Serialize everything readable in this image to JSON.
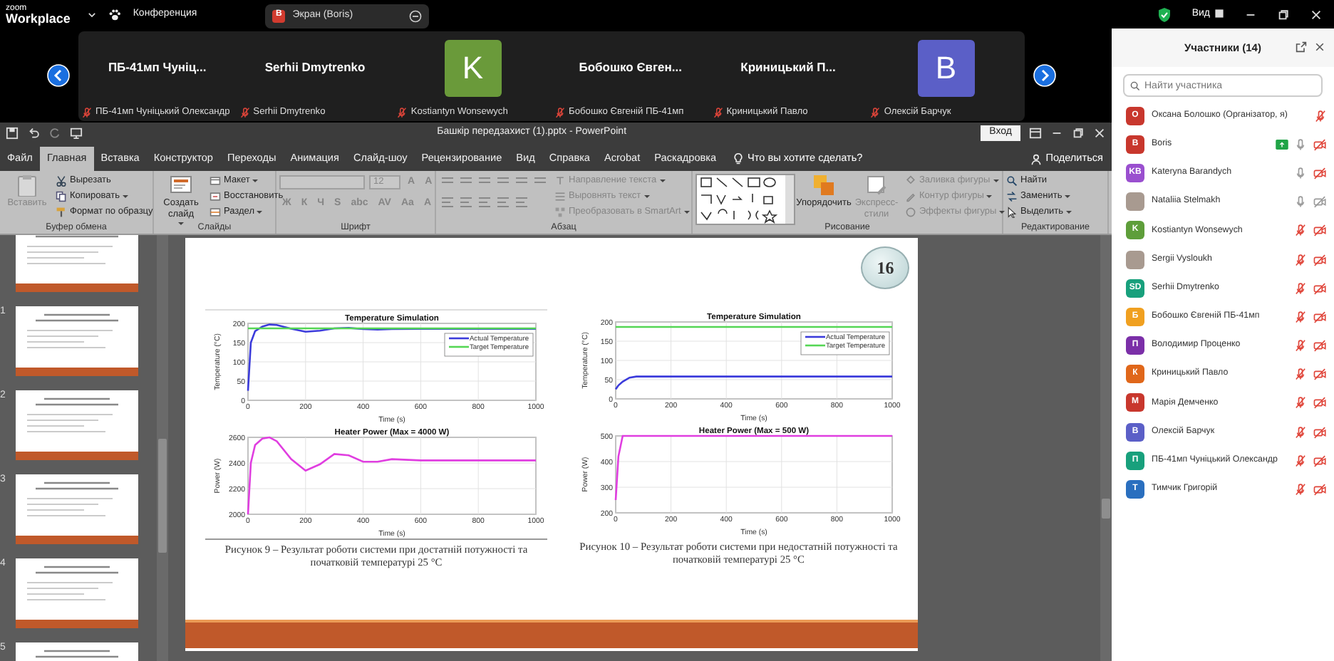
{
  "zoom": {
    "logo_small": "zoom",
    "logo": "Workplace",
    "meeting_menu": "Конференция",
    "share_pill": {
      "initial": "B",
      "label": "Экран (Boris)"
    },
    "view_label": "Вид"
  },
  "gallery": {
    "tiles": [
      {
        "kind": "name",
        "display": "ПБ-41мп Чуніц...",
        "tag": "ПБ-41мп Чуніцький Олександр",
        "muted": true
      },
      {
        "kind": "name",
        "display": "Serhii Dmytrenko",
        "tag": "Serhii Dmytrenko",
        "muted": true
      },
      {
        "kind": "avatar",
        "display": "K",
        "color": "#6a9a3a",
        "tag": "Kostiantyn Wonsewych",
        "muted": true
      },
      {
        "kind": "name",
        "display": "Бобошко Євген...",
        "tag": "Бобошко Євгеній ПБ-41мп",
        "muted": true
      },
      {
        "kind": "name",
        "display": "Криницький П...",
        "tag": "Криницький Павло",
        "muted": true
      },
      {
        "kind": "avatar",
        "display": "B",
        "color": "#5b5fc7",
        "tag": "Олексій Барчук",
        "muted": true
      }
    ]
  },
  "powerpoint": {
    "title": "Башкір передзахист (1).pptx - PowerPoint",
    "signin": "Вход",
    "tabs": [
      {
        "label": "Файл",
        "selected": false
      },
      {
        "label": "Главная",
        "selected": true
      },
      {
        "label": "Вставка",
        "selected": false
      },
      {
        "label": "Конструктор",
        "selected": false
      },
      {
        "label": "Переходы",
        "selected": false
      },
      {
        "label": "Анимация",
        "selected": false
      },
      {
        "label": "Слайд-шоу",
        "selected": false
      },
      {
        "label": "Рецензирование",
        "selected": false
      },
      {
        "label": "Вид",
        "selected": false
      },
      {
        "label": "Справка",
        "selected": false
      },
      {
        "label": "Acrobat",
        "selected": false
      },
      {
        "label": "Раскадровка",
        "selected": false
      }
    ],
    "search_hint": "Что вы хотите сделать?",
    "share": "Поделиться",
    "ribbon": {
      "groups": [
        {
          "label": "Буфер обмена",
          "items": [
            {
              "kind": "large",
              "label": "Вставить",
              "disabled": true,
              "dropdown": false
            },
            {
              "kind": "small",
              "label": "Вырезать",
              "disabled": false,
              "dropdown": false
            },
            {
              "kind": "small",
              "label": "Копировать",
              "disabled": false,
              "dropdown": true
            },
            {
              "kind": "small",
              "label": "Формат по образцу",
              "disabled": false,
              "dropdown": false
            }
          ]
        },
        {
          "label": "Слайды",
          "items": [
            {
              "kind": "large",
              "label": "Создать слайд",
              "disabled": false,
              "dropdown": true
            },
            {
              "kind": "small",
              "label": "Макет",
              "disabled": false,
              "dropdown": true
            },
            {
              "kind": "small",
              "label": "Восстановить",
              "disabled": false,
              "dropdown": false
            },
            {
              "kind": "small",
              "label": "Раздел",
              "disabled": false,
              "dropdown": true
            }
          ]
        },
        {
          "label": "Шрифт",
          "items": [
            {
              "kind": "font",
              "disabled": true,
              "size": "12",
              "size_buttons": [
                "A",
                "A"
              ],
              "format_buttons": [
                "Ж",
                "К",
                "Ч",
                "S",
                "abc",
                "AV",
                "Aa",
                "A"
              ]
            }
          ]
        },
        {
          "label": "Абзац",
          "items": [
            {
              "kind": "paragraph_icons",
              "disabled": true
            },
            {
              "kind": "small",
              "label": "Направление текста",
              "disabled": true,
              "dropdown": true
            },
            {
              "kind": "small",
              "label": "Выровнять текст",
              "disabled": true,
              "dropdown": true
            },
            {
              "kind": "small",
              "label": "Преобразовать в SmartArt",
              "disabled": true,
              "dropdown": true
            }
          ]
        },
        {
          "label": "Рисование",
          "items": [
            {
              "kind": "shapes",
              "disabled": false
            },
            {
              "kind": "large",
              "label": "Упорядочить",
              "disabled": false,
              "dropdown": false
            },
            {
              "kind": "large",
              "label": "Экспресс-стили",
              "disabled": true,
              "dropdown": false
            },
            {
              "kind": "small",
              "label": "Заливка фигуры",
              "disabled": true,
              "dropdown": true
            },
            {
              "kind": "small",
              "label": "Контур фигуры",
              "disabled": true,
              "dropdown": true
            },
            {
              "kind": "small",
              "label": "Эффекты фигуры",
              "disabled": true,
              "dropdown": true
            }
          ]
        },
        {
          "label": "Редактирование",
          "items": [
            {
              "kind": "small",
              "label": "Найти",
              "disabled": false,
              "dropdown": false
            },
            {
              "kind": "small",
              "label": "Заменить",
              "disabled": false,
              "dropdown": true
            },
            {
              "kind": "small",
              "label": "Выделить",
              "disabled": false,
              "dropdown": true
            }
          ]
        }
      ]
    },
    "thumbnails": [
      "1",
      "2",
      "3",
      "4",
      "5"
    ],
    "slide": {
      "number": "16",
      "figures": [
        {
          "caption": "Рисунок 9 – Результат роботи системи при достатній потужності та початковій температурі 25  °C",
          "charts": [
            {
              "chart_data": {
                "type": "line",
                "title": "Temperature Simulation",
                "xlabel": "Time (s)",
                "ylabel": "Temperature (°C)",
                "x": [
                  0,
                  10,
                  25,
                  50,
                  75,
                  100,
                  150,
                  200,
                  250,
                  300,
                  350,
                  400,
                  450,
                  500,
                  600,
                  700,
                  800,
                  900,
                  1000
                ],
                "series": [
                  {
                    "name": "Actual Temperature",
                    "color": "#3b3bdb",
                    "values": [
                      25,
                      150,
                      180,
                      192,
                      197,
                      196,
                      186,
                      178,
                      181,
                      187,
                      188,
                      185,
                      184,
                      185,
                      186,
                      186,
                      186,
                      186,
                      186
                    ]
                  },
                  {
                    "name": "Target Temperature",
                    "color": "#55d655",
                    "values": [
                      187,
                      187,
                      187,
                      187,
                      187,
                      187,
                      187,
                      187,
                      187,
                      187,
                      187,
                      187,
                      187,
                      187,
                      187,
                      187,
                      187,
                      187,
                      187
                    ]
                  }
                ],
                "xlim": [
                  0,
                  1000
                ],
                "ylim": [
                  0,
                  200
                ],
                "xticks": [
                  0,
                  200,
                  400,
                  600,
                  800,
                  1000
                ],
                "yticks": [
                  0,
                  50,
                  100,
                  150,
                  200
                ],
                "grid": true,
                "legend": "upper right"
              }
            },
            {
              "chart_data": {
                "type": "line",
                "title": "Heater Power (Max = 4000 W)",
                "xlabel": "Time (s)",
                "ylabel": "Power (W)",
                "x": [
                  0,
                  10,
                  25,
                  50,
                  75,
                  100,
                  150,
                  200,
                  250,
                  300,
                  350,
                  400,
                  450,
                  500,
                  600,
                  700,
                  800,
                  900,
                  1000
                ],
                "series": [
                  {
                    "color": "#e03ee0",
                    "values": [
                      2000,
                      2400,
                      2540,
                      2590,
                      2600,
                      2570,
                      2430,
                      2340,
                      2390,
                      2470,
                      2460,
                      2410,
                      2410,
                      2430,
                      2420,
                      2420,
                      2420,
                      2420,
                      2420
                    ]
                  }
                ],
                "xlim": [
                  0,
                  1000
                ],
                "ylim": [
                  2000,
                  2600
                ],
                "xticks": [
                  0,
                  200,
                  400,
                  600,
                  800,
                  1000
                ],
                "yticks": [
                  2000,
                  2200,
                  2400,
                  2600
                ],
                "grid": true
              }
            }
          ]
        },
        {
          "caption": "Рисунок 10 – Результат роботи системи при недостатній потужності та початковій температурі 25 °C",
          "charts": [
            {
              "chart_data": {
                "type": "line",
                "title": "Temperature Simulation",
                "xlabel": "Time (s)",
                "ylabel": "Temperature (°C)",
                "x": [
                  0,
                  10,
                  25,
                  50,
                  75,
                  100,
                  150,
                  200,
                  250,
                  300,
                  350,
                  400,
                  450,
                  500,
                  600,
                  700,
                  800,
                  900,
                  1000
                ],
                "series": [
                  {
                    "name": "Actual Temperature",
                    "color": "#3b3bdb",
                    "values": [
                      25,
                      35,
                      45,
                      55,
                      58,
                      58,
                      58,
                      58,
                      58,
                      58,
                      58,
                      58,
                      58,
                      58,
                      58,
                      58,
                      58,
                      58,
                      58
                    ]
                  },
                  {
                    "name": "Target Temperature",
                    "color": "#55d655",
                    "values": [
                      187,
                      187,
                      187,
                      187,
                      187,
                      187,
                      187,
                      187,
                      187,
                      187,
                      187,
                      187,
                      187,
                      187,
                      187,
                      187,
                      187,
                      187,
                      187
                    ]
                  }
                ],
                "xlim": [
                  0,
                  1000
                ],
                "ylim": [
                  0,
                  200
                ],
                "xticks": [
                  0,
                  200,
                  400,
                  600,
                  800,
                  1000
                ],
                "yticks": [
                  0,
                  50,
                  100,
                  150,
                  200
                ],
                "grid": true,
                "legend": "upper right"
              }
            },
            {
              "chart_data": {
                "type": "line",
                "title": "Heater Power (Max = 500 W)",
                "xlabel": "Time (s)",
                "ylabel": "Power (W)",
                "x": [
                  0,
                  10,
                  25,
                  50,
                  75,
                  100,
                  150,
                  200,
                  250,
                  300,
                  350,
                  400,
                  450,
                  500,
                  600,
                  700,
                  800,
                  900,
                  1000
                ],
                "series": [
                  {
                    "color": "#e03ee0",
                    "values": [
                      250,
                      420,
                      500,
                      500,
                      500,
                      500,
                      500,
                      500,
                      500,
                      500,
                      500,
                      500,
                      500,
                      500,
                      500,
                      500,
                      500,
                      500,
                      500
                    ]
                  }
                ],
                "xlim": [
                  0,
                  1000
                ],
                "ylim": [
                  200,
                  500
                ],
                "xticks": [
                  0,
                  200,
                  400,
                  600,
                  800,
                  1000
                ],
                "yticks": [
                  200,
                  300,
                  400,
                  500
                ],
                "grid": true
              }
            }
          ]
        }
      ]
    }
  },
  "participants": {
    "title": "Участники (14)",
    "search": {
      "placeholder": "Найти участника"
    },
    "items": [
      {
        "kind": "initials",
        "initials": "О",
        "color": "#c8372d",
        "name": "Оксана Болошко (Організатор, я)",
        "sharing": false,
        "muted": true
      },
      {
        "kind": "initials",
        "initials": "B",
        "color": "#c8372d",
        "name": "Boris",
        "sharing": true,
        "muted": false,
        "video_off": true
      },
      {
        "kind": "initials",
        "initials": "KB",
        "color": "#9a4fcf",
        "name": "Kateryna Barandych",
        "sharing": false,
        "muted": false,
        "video_off": true
      },
      {
        "kind": "photo",
        "name": "Nataliia Stelmakh",
        "sharing": false,
        "muted": false,
        "video_off": false
      },
      {
        "kind": "initials",
        "initials": "K",
        "color": "#5e9e3a",
        "name": "Kostiantyn Wonsewych",
        "sharing": false,
        "muted": true,
        "video_off": true
      },
      {
        "kind": "photo",
        "name": "Sergii Vysloukh",
        "sharing": false,
        "muted": true,
        "video_off": true
      },
      {
        "kind": "initials",
        "initials": "SD",
        "color": "#18a07c",
        "name": "Serhii Dmytrenko",
        "sharing": false,
        "muted": true,
        "video_off": true
      },
      {
        "kind": "initials",
        "initials": "Б",
        "color": "#f0a020",
        "name": "Бобошко Євгеній ПБ-41мп",
        "sharing": false,
        "muted": true,
        "video_off": true
      },
      {
        "kind": "initials",
        "initials": "П",
        "color": "#7b2fa8",
        "name": "Володимир Проценко",
        "sharing": false,
        "muted": true,
        "video_off": true
      },
      {
        "kind": "initials",
        "initials": "К",
        "color": "#e0671a",
        "name": "Криницький Павло",
        "sharing": false,
        "muted": true,
        "video_off": true
      },
      {
        "kind": "initials",
        "initials": "М",
        "color": "#c8372d",
        "name": "Марія Демченко",
        "sharing": false,
        "muted": true,
        "video_off": true
      },
      {
        "kind": "initials",
        "initials": "В",
        "color": "#5b5fc7",
        "name": "Олексій Барчук",
        "sharing": false,
        "muted": true,
        "video_off": true
      },
      {
        "kind": "initials",
        "initials": "П",
        "color": "#18a07c",
        "name": "ПБ-41мп Чуніцький Олександр",
        "sharing": false,
        "muted": true,
        "video_off": true
      },
      {
        "kind": "initials",
        "initials": "Т",
        "color": "#2a6fbf",
        "name": "Тимчик Григорій",
        "sharing": false,
        "muted": true,
        "video_off": true
      }
    ]
  }
}
